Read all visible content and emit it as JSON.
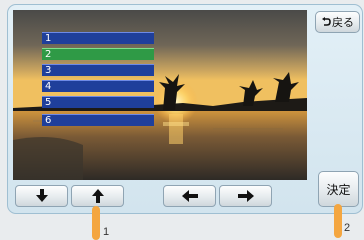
{
  "back_button": {
    "label": "戻る",
    "icon": "return-arrow-icon"
  },
  "list": {
    "items": [
      {
        "label": "1",
        "selected": false
      },
      {
        "label": "2",
        "selected": true
      },
      {
        "label": "3",
        "selected": false
      },
      {
        "label": "4",
        "selected": false
      },
      {
        "label": "5",
        "selected": false
      },
      {
        "label": "6",
        "selected": false
      }
    ]
  },
  "bottom_controls": {
    "down_icon": "arrow-down-icon",
    "up_icon": "arrow-up-icon",
    "left_icon": "arrow-left-icon",
    "right_icon": "arrow-right-icon",
    "confirm_label": "決定"
  },
  "callouts": {
    "one": "1",
    "two": "2"
  },
  "colors": {
    "list_item": "#1f3f9b",
    "list_item_selected": "#2f9a46",
    "callout": "#f4a640",
    "frame": "#dbeaf3"
  }
}
